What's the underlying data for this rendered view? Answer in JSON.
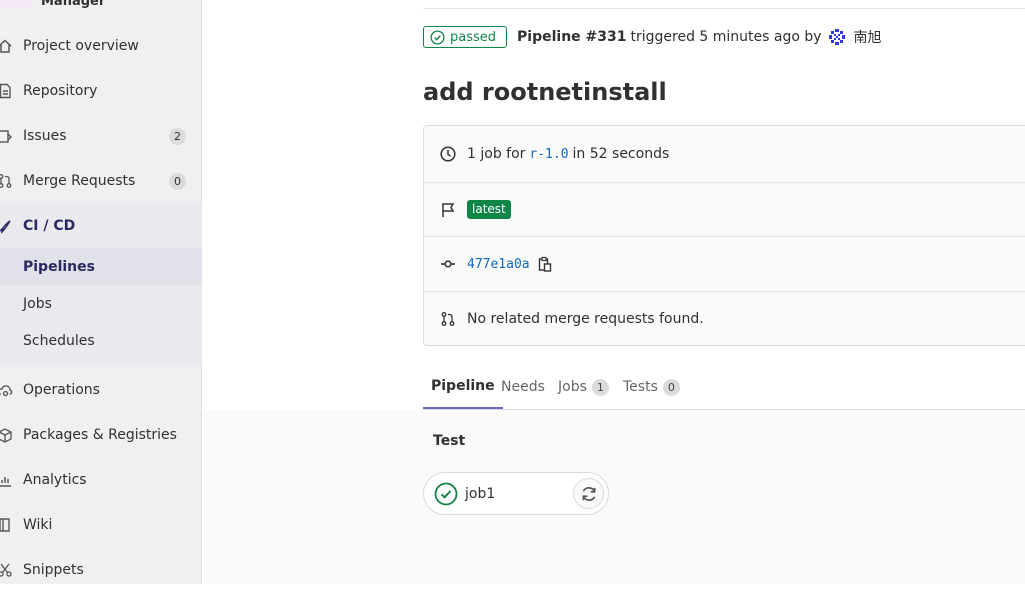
{
  "project": {
    "name": "Manager"
  },
  "sidebar": {
    "items": [
      {
        "label": "Project overview",
        "icon": "home-icon"
      },
      {
        "label": "Repository",
        "icon": "doc-icon"
      },
      {
        "label": "Issues",
        "icon": "issues-icon",
        "count": "2"
      },
      {
        "label": "Merge Requests",
        "icon": "merge-request-icon",
        "count": "0"
      },
      {
        "label": "CI / CD",
        "icon": "rocket-icon"
      },
      {
        "label": "Operations",
        "icon": "cloud-gear-icon"
      },
      {
        "label": "Packages & Registries",
        "icon": "package-icon"
      },
      {
        "label": "Analytics",
        "icon": "chart-icon"
      },
      {
        "label": "Wiki",
        "icon": "book-icon"
      },
      {
        "label": "Snippets",
        "icon": "scissors-icon"
      }
    ],
    "cicd_sub": [
      {
        "label": "Pipelines",
        "active": true
      },
      {
        "label": "Jobs"
      },
      {
        "label": "Schedules"
      }
    ]
  },
  "header": {
    "status": "passed",
    "pipeline_ref": "Pipeline #331",
    "triggered_text": "triggered 5 minutes ago by",
    "user_name": "南旭"
  },
  "title": "add rootnetinstall",
  "info": {
    "jobs_prefix": "1 job for",
    "branch": "r-1.0",
    "jobs_suffix": "in 52 seconds",
    "latest_badge": "latest",
    "commit_sha": "477e1a0a",
    "merge_text": "No related merge requests found."
  },
  "tabs": [
    {
      "label": "Pipeline",
      "active": true
    },
    {
      "label": "Needs"
    },
    {
      "label": "Jobs",
      "count": "1"
    },
    {
      "label": "Tests",
      "count": "0"
    }
  ],
  "stage": {
    "title": "Test",
    "job_name": "job1",
    "job_status": "success"
  },
  "colors": {
    "success": "#108548",
    "link": "#1068bf",
    "active_nav": "#292961",
    "tab_indicator": "#6666c4"
  }
}
